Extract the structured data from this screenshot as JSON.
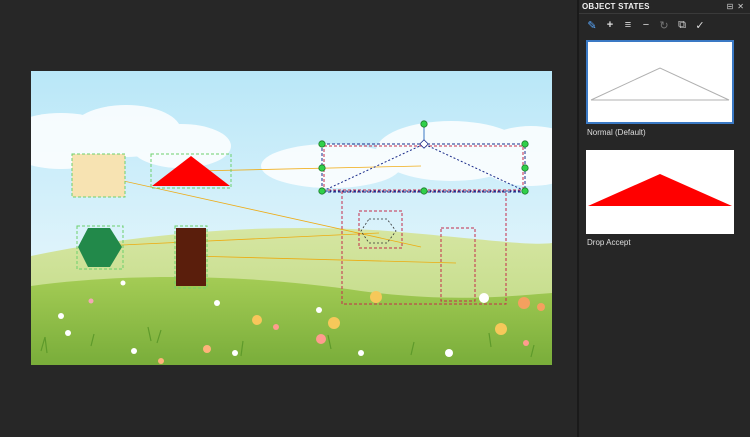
{
  "panel": {
    "title": "OBJECT STATES",
    "pin_icon": "pin-icon",
    "close_icon": "close-icon",
    "toolbar": [
      {
        "name": "edit-state-button",
        "icon": "edit-icon",
        "glyph": "✎"
      },
      {
        "name": "add-state-button",
        "icon": "plus-icon",
        "glyph": "+"
      },
      {
        "name": "duplicate-state-button",
        "icon": "copy-states-icon",
        "glyph": "≡"
      },
      {
        "name": "delete-state-button",
        "icon": "minus-icon",
        "glyph": "−"
      },
      {
        "name": "reset-state-button",
        "icon": "reset-icon",
        "glyph": "↻"
      },
      {
        "name": "copy-state-button",
        "icon": "copy-icon",
        "glyph": "⧉"
      },
      {
        "name": "done-button",
        "icon": "check-icon",
        "glyph": "✓"
      }
    ],
    "states": [
      {
        "label": "Normal (Default)",
        "selected": true
      },
      {
        "label": "Drop Accept",
        "selected": false
      }
    ]
  },
  "colors": {
    "selection": "#3a79c4",
    "triangle_red": "#ff0000",
    "hexagon_green": "#22894a",
    "rect_brown": "#5a1e0c",
    "beige": "#f7e3b2"
  }
}
